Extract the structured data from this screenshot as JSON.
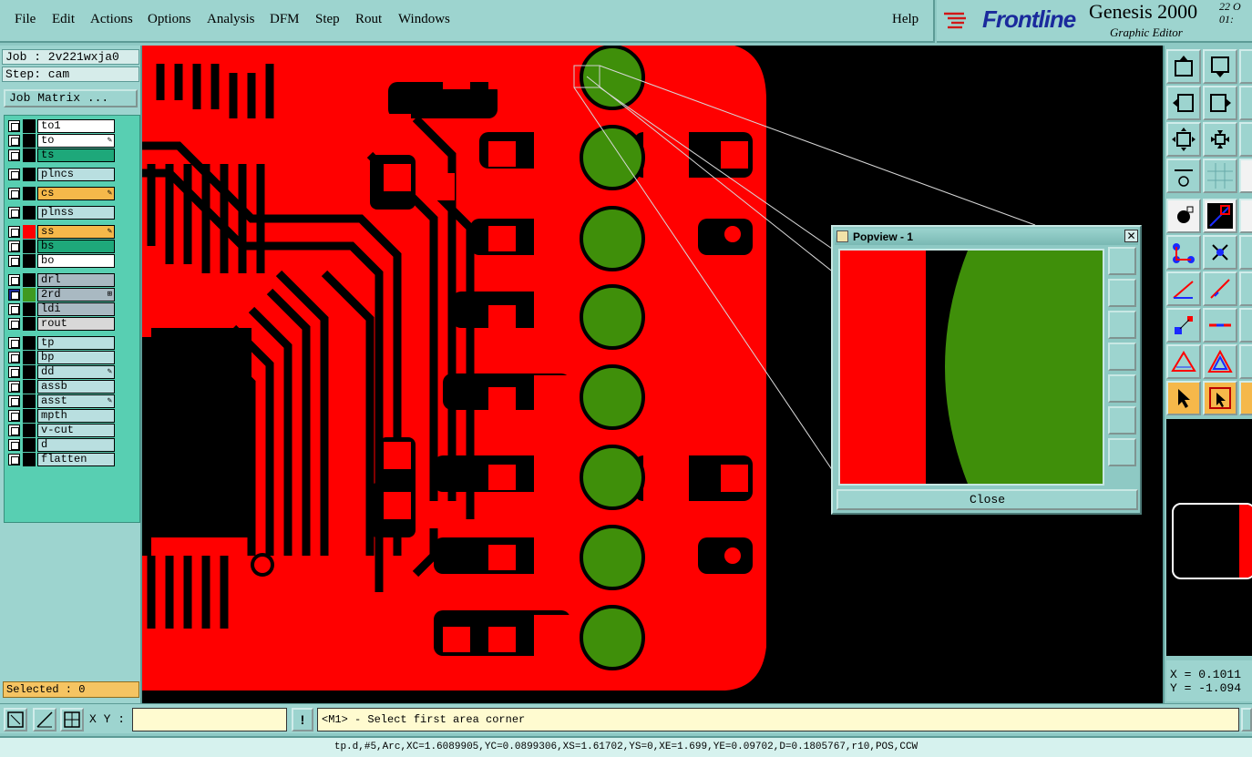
{
  "menu": [
    {
      "label": "File",
      "name": "menu-file"
    },
    {
      "label": "Edit",
      "name": "menu-edit"
    },
    {
      "label": "Actions",
      "name": "menu-actions"
    },
    {
      "label": "Options",
      "name": "menu-options"
    },
    {
      "label": "Analysis",
      "name": "menu-analysis"
    },
    {
      "label": "DFM",
      "name": "menu-dfm"
    },
    {
      "label": "Step",
      "name": "menu-step"
    },
    {
      "label": "Rout",
      "name": "menu-rout"
    },
    {
      "label": "Windows",
      "name": "menu-windows"
    },
    {
      "label": "Help",
      "name": "menu-help"
    }
  ],
  "brand": {
    "logo": "Frontline",
    "title": "Genesis 2000",
    "subtitle": "Graphic Editor",
    "date": "22 O",
    "time": "01:"
  },
  "job": {
    "job_line": "Job : 2v221wxja0",
    "step_line": "Step: cam",
    "matrix_button": "Job Matrix ..."
  },
  "layers": [
    {
      "name": "to1",
      "color": "#000000",
      "bg": "#ffffff",
      "mark": ""
    },
    {
      "name": "to",
      "color": "#000000",
      "bg": "#ffffff",
      "mark": "✎"
    },
    {
      "name": "ts",
      "color": "#000000",
      "bg": "#1ea87a",
      "mark": ""
    },
    {
      "name": "plncs",
      "color": "#000000",
      "bg": "#b9dfe0",
      "mark": ""
    },
    {
      "name": "cs",
      "color": "#000000",
      "bg": "#f5b84a",
      "mark": "✎"
    },
    {
      "name": "plnss",
      "color": "#000000",
      "bg": "#b9dfe0",
      "mark": ""
    },
    {
      "name": "ss",
      "color": "#ff0000",
      "bg": "#f5b84a",
      "mark": "✎"
    },
    {
      "name": "bs",
      "color": "#000000",
      "bg": "#1ea87a",
      "mark": ""
    },
    {
      "name": "bo",
      "color": "#000000",
      "bg": "#ffffff",
      "mark": ""
    },
    {
      "name": "drl",
      "color": "#000000",
      "bg": "#a9b9c2",
      "mark": ""
    },
    {
      "name": "2rd",
      "color": "#3f9a20",
      "bg": "#a9b9c2",
      "mark": "⊞"
    },
    {
      "name": "ldi",
      "color": "#000000",
      "bg": "#a9b9c2",
      "mark": ""
    },
    {
      "name": "rout",
      "color": "#000000",
      "bg": "#d8d8d8",
      "mark": ""
    },
    {
      "name": "tp",
      "color": "#000000",
      "bg": "#b9dfe0",
      "mark": ""
    },
    {
      "name": "bp",
      "color": "#000000",
      "bg": "#b9dfe0",
      "mark": ""
    },
    {
      "name": "dd",
      "color": "#000000",
      "bg": "#b9dfe0",
      "mark": "✎"
    },
    {
      "name": "assb",
      "color": "#000000",
      "bg": "#b9dfe0",
      "mark": ""
    },
    {
      "name": "asst",
      "color": "#000000",
      "bg": "#b9dfe0",
      "mark": "✎"
    },
    {
      "name": "mpth",
      "color": "#000000",
      "bg": "#b9dfe0",
      "mark": ""
    },
    {
      "name": "v-cut",
      "color": "#000000",
      "bg": "#b9dfe0",
      "mark": ""
    },
    {
      "name": "d",
      "color": "#000000",
      "bg": "#b9dfe0",
      "mark": ""
    },
    {
      "name": "flatten",
      "color": "#000000",
      "bg": "#b9dfe0",
      "mark": ""
    }
  ],
  "selected": "Selected : 0",
  "popview": {
    "title": "Popview - 1",
    "close_label": "Close"
  },
  "coords": {
    "x": "X = 0.1011",
    "y": "Y = -1.094"
  },
  "bottom": {
    "xy_label": "X Y :",
    "xy_value": "",
    "alert": "!",
    "prompt": "<M1> - Select first area corner"
  },
  "status": "tp.d,#5,Arc,XC=1.6089905,YC=0.0899306,XS=1.61702,YS=0,XE=1.699,YE=0.09702,D=0.1805767,r10,POS,CCW",
  "colors": {
    "copper": "#ff0000",
    "pad": "#3f8f0a",
    "canvas_bg": "#000000",
    "panel": "#9dd4cf"
  }
}
